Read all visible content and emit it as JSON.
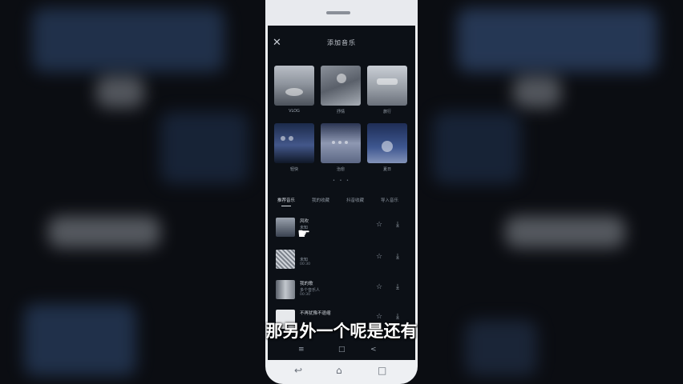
{
  "header": {
    "close_glyph": "✕",
    "title": "添加音乐"
  },
  "categories": [
    {
      "label": "VLOG",
      "thumb": "t1"
    },
    {
      "label": "抒情",
      "thumb": "t2"
    },
    {
      "label": "旅行",
      "thumb": "t3"
    },
    {
      "label": "轻快",
      "thumb": "t4"
    },
    {
      "label": "治愈",
      "thumb": "t5"
    },
    {
      "label": "夏日",
      "thumb": "t6"
    }
  ],
  "pager_dots": "• • •",
  "tabs": [
    "推荐音乐",
    "我的收藏",
    "抖音收藏",
    "导入音乐"
  ],
  "songs": [
    {
      "title": "风吹",
      "artist": "未知",
      "time": "",
      "cover": "c1"
    },
    {
      "title": "",
      "artist": "未知",
      "time": "00:30",
      "cover": "c2"
    },
    {
      "title": "我的歌",
      "artist": "多个音乐人",
      "time": "00:30",
      "cover": "c3"
    },
    {
      "title": "不再犹豫不退缩",
      "artist": "",
      "time": "",
      "cover": "c4"
    }
  ],
  "icons": {
    "favorite": "☆",
    "download": "⤓",
    "pointer_hand": "☛"
  },
  "nav_icons": [
    "≡",
    "□",
    "<"
  ],
  "softkeys": [
    "↩",
    "⌂",
    "□"
  ],
  "subtitle": "那另外一个呢是还有"
}
